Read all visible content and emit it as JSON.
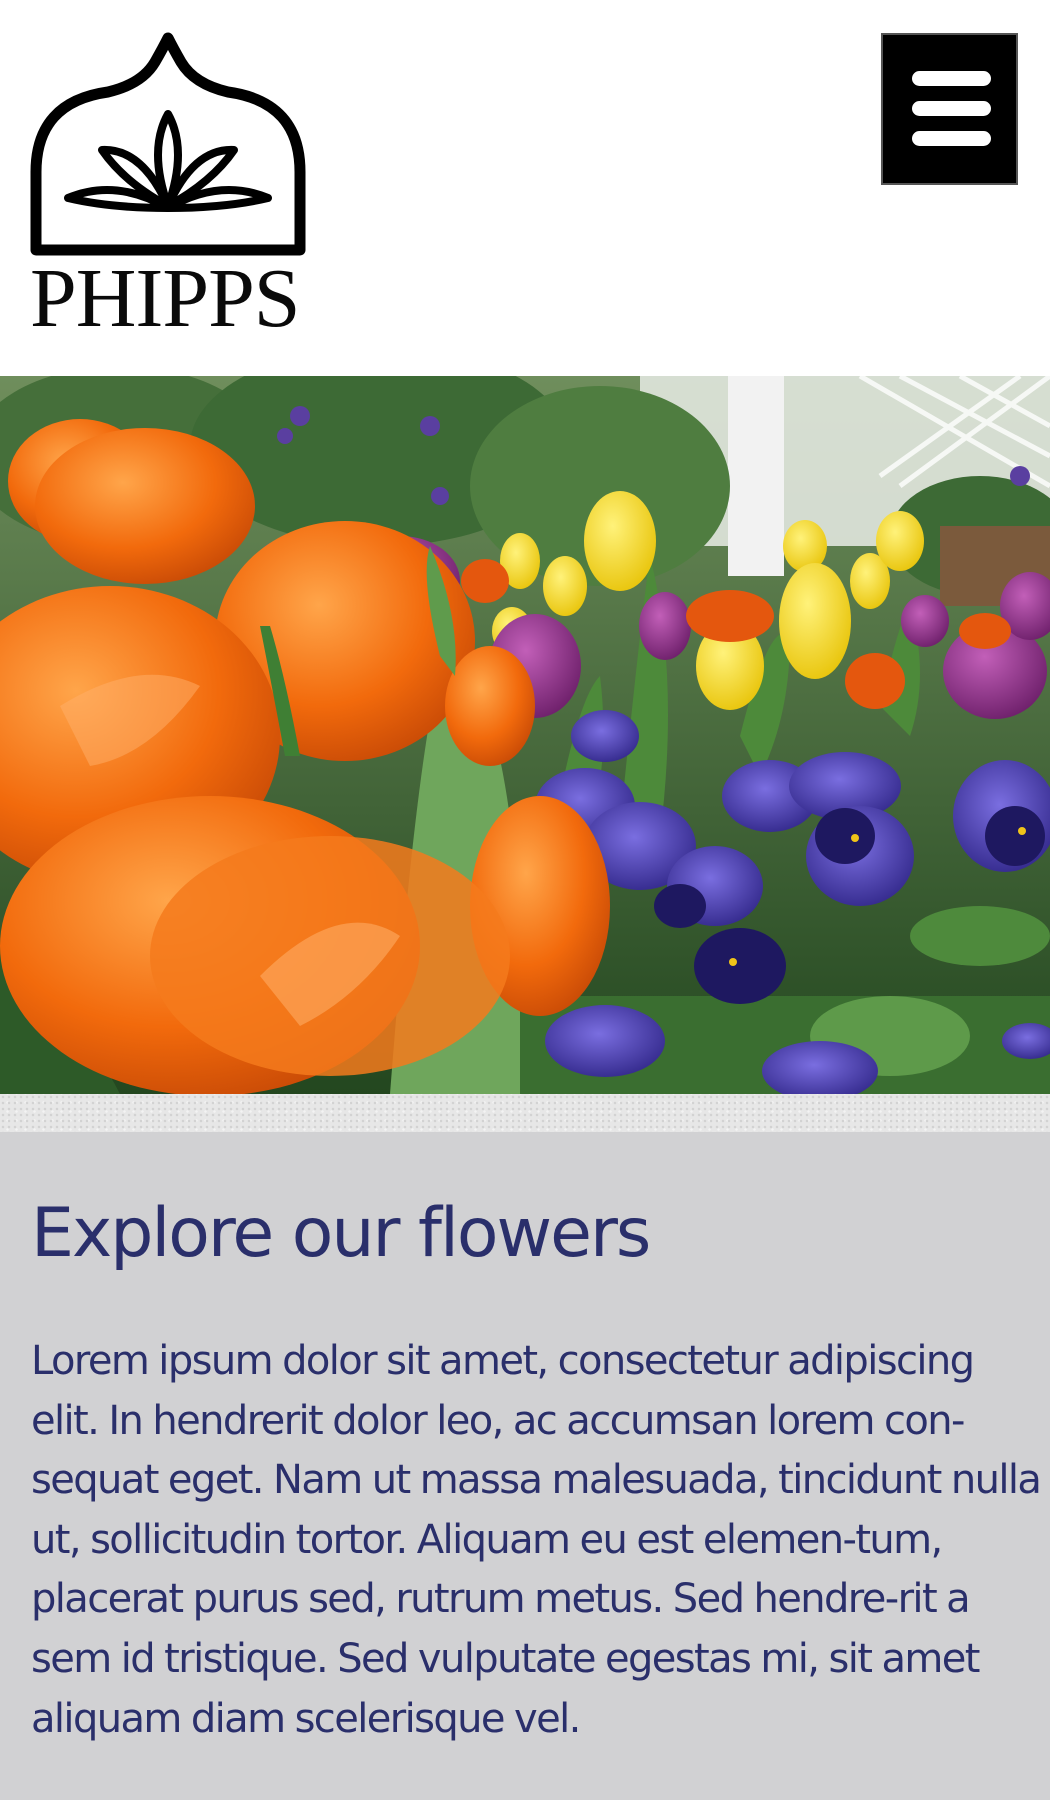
{
  "header": {
    "logo_text": "PHIPPS",
    "menu_icon": "hamburger-menu-icon"
  },
  "hero": {
    "image": "tulips-and-pansies-photo"
  },
  "content": {
    "title": "Explore our flowers",
    "body": "Lorem ipsum dolor sit amet, consectetur adipiscing elit. In hendrerit dolor leo, ac accumsan lorem con-sequat eget. Nam ut massa malesuada, tincidunt nulla ut, sollicitudin tortor. Aliquam eu est elemen-tum, placerat purus sed, rutrum metus. Sed hendre-rit a sem id tristique. Sed vulputate egestas mi, sit amet aliquam diam scelerisque vel."
  },
  "colors": {
    "heading_text": "#2a2f6b",
    "content_background": "#d1d1d3",
    "menu_button": "#000000"
  }
}
